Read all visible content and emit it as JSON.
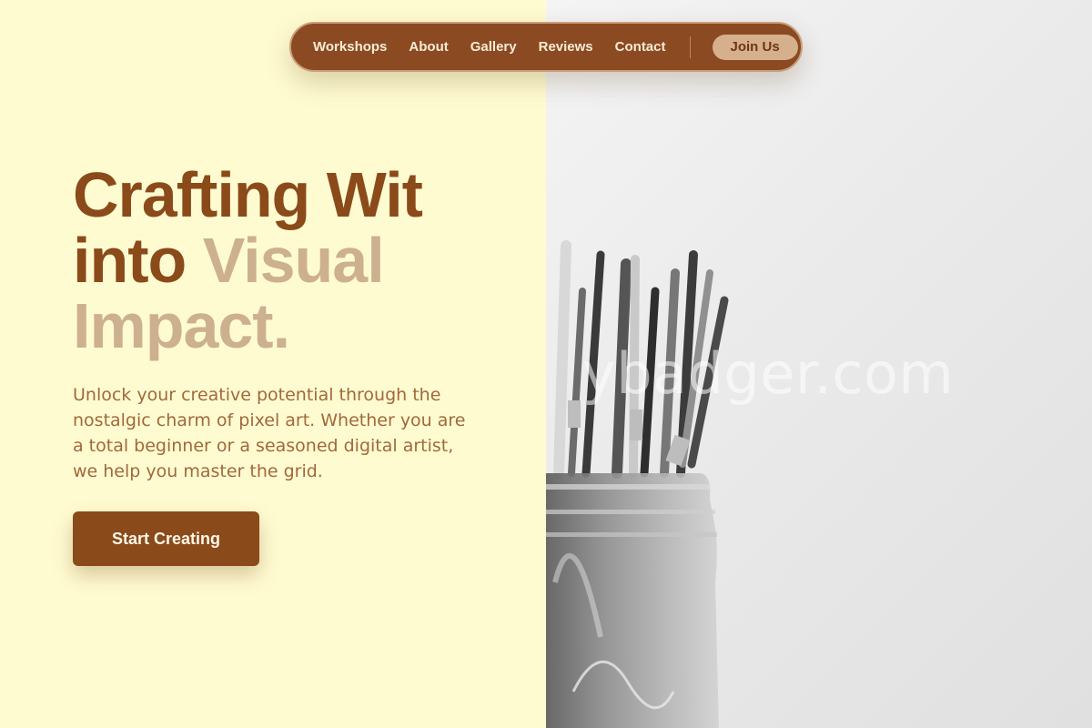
{
  "nav": {
    "links": [
      "Workshops",
      "About",
      "Gallery",
      "Reviews",
      "Contact"
    ],
    "join_label": "Join Us"
  },
  "hero": {
    "title_line1": "Crafting Wit",
    "title_line2_a": "into",
    "title_line2_b": "Visual",
    "title_line3": "Impact.",
    "description": "Unlock your creative potential through the nostalgic charm of pixel art. Whether you are a total beginner or a seasoned digital artist, we help you master the grid.",
    "cta_label": "Start Creating"
  },
  "image": {
    "subject": "paintbrushes-in-glass-jar",
    "watermark": "ybadger.com"
  },
  "colors": {
    "cream_background": "#fffbd1",
    "brand_brown": "#8b4a1a",
    "accent_tan": "#cdb08f",
    "text_brown": "#a2683a"
  }
}
